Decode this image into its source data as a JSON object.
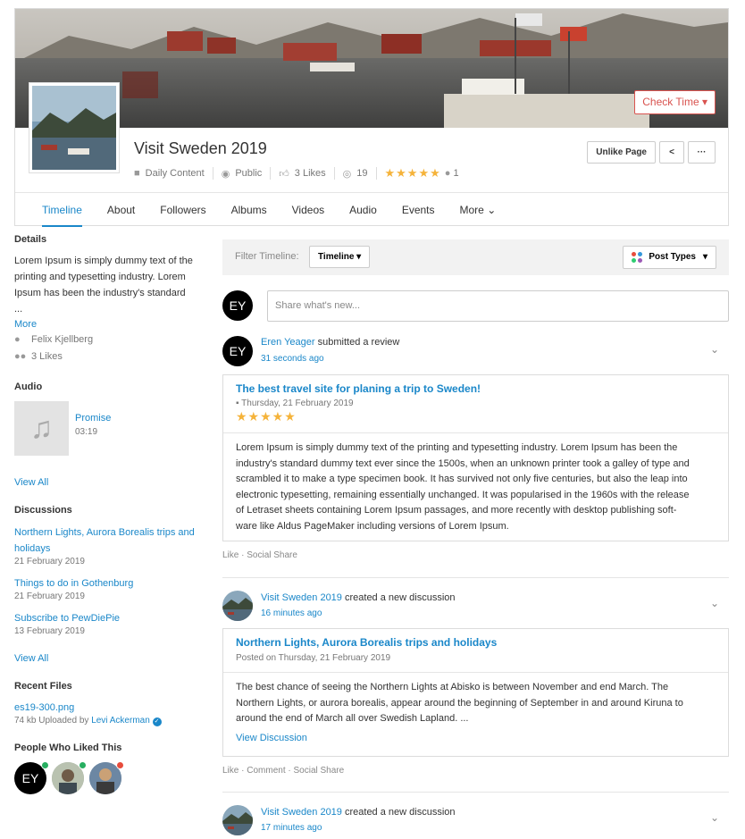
{
  "header": {
    "check_time": "Check Time",
    "page_title": "Visit Sweden 2019",
    "category": "Daily Content",
    "privacy": "Public",
    "likes": "3 Likes",
    "views": "19",
    "rating_stars": 5,
    "raters": "1",
    "unlike_button": "Unlike Page"
  },
  "tabs": [
    "Timeline",
    "About",
    "Followers",
    "Albums",
    "Videos",
    "Audio",
    "Events",
    "More"
  ],
  "sidebar": {
    "details_title": "Details",
    "details_text_1": "Lorem Ipsum is simply dummy text of the",
    "details_text_2": "printing and typesetting industry. Lorem",
    "details_text_3": "Ipsum has been the industry's standard",
    "details_text_4": "...",
    "more_link": "More",
    "owner": "Felix Kjellberg",
    "likes": "3 Likes",
    "audio_title": "Audio",
    "audio_track": "Promise",
    "audio_duration": "03:19",
    "view_all_1": "View All",
    "discussions_title": "Discussions",
    "discussions": [
      {
        "title_1": "Northern Lights, Aurora Borealis trips and",
        "title_2": "holidays",
        "date": "21 February 2019"
      },
      {
        "title_1": "Things to do in Gothenburg",
        "title_2": "",
        "date": "21 February 2019"
      },
      {
        "title_1": "Subscribe to PewDiePie",
        "title_2": "",
        "date": "13 February 2019"
      }
    ],
    "view_all_2": "View All",
    "recent_files_title": "Recent Files",
    "file_name": "es19-300.png",
    "file_meta": "74 kb Uploaded by",
    "file_uploader": "Levi Ackerman",
    "liked_title": "People Who Liked This",
    "liker_initials": "EY",
    "liker_status_colors": [
      "#27ae60",
      "#27ae60",
      "#e74c3c"
    ]
  },
  "main": {
    "filter_label": "Filter Timeline:",
    "filter_value": "Timeline",
    "post_types": "Post Types",
    "composer_placeholder": "Share what's new...",
    "avatar_initials": "EY",
    "post1": {
      "author": "Eren Yeager",
      "action": "submitted a review",
      "time": "31 seconds ago",
      "title": "The best travel site for planing a trip to Sweden!",
      "date": "Thursday, 21 February 2019",
      "stars": 5,
      "body_1": "Lorem Ipsum is simply dummy text of the printing and typesetting industry. Lorem Ipsum has been the",
      "body_2": "industry's standard dummy text ever since the 1500s, when an unknown printer took a galley of type and",
      "body_3": "scrambled it to make a type specimen book. It has survived not only five centuries, but also the leap into",
      "body_4": "electronic typesetting, remaining essentially unchanged. It was popularised in the 1960s with the release",
      "body_5": "of Letraset sheets containing Lorem Ipsum passages, and more recently with desktop publishing soft-",
      "body_6": "ware like Aldus PageMaker including versions of Lorem Ipsum.",
      "like": "Like",
      "share": "Social Share"
    },
    "post2": {
      "author": "Visit Sweden 2019",
      "action": "created a new discussion",
      "time": "16 minutes ago",
      "title": "Northern Lights, Aurora Borealis trips and holidays",
      "posted": "Posted on Thursday, 21 February 2019",
      "body_1": "The best chance of seeing the Northern Lights at Abisko is between November and end March. The",
      "body_2": "Northern Lights, or aurora borealis, appear around the beginning of September in and around Kiruna to",
      "body_3": "around the end of March all over Swedish Lapland. ...",
      "view_discussion": "View Discussion",
      "like": "Like",
      "comment": "Comment",
      "share": "Social Share"
    },
    "post3": {
      "author": "Visit Sweden 2019",
      "action": "created a new discussion",
      "time": "17 minutes ago"
    }
  },
  "colors": {
    "accent": "#1a87c9",
    "danger": "#d9534f",
    "star": "#f5b33a"
  }
}
